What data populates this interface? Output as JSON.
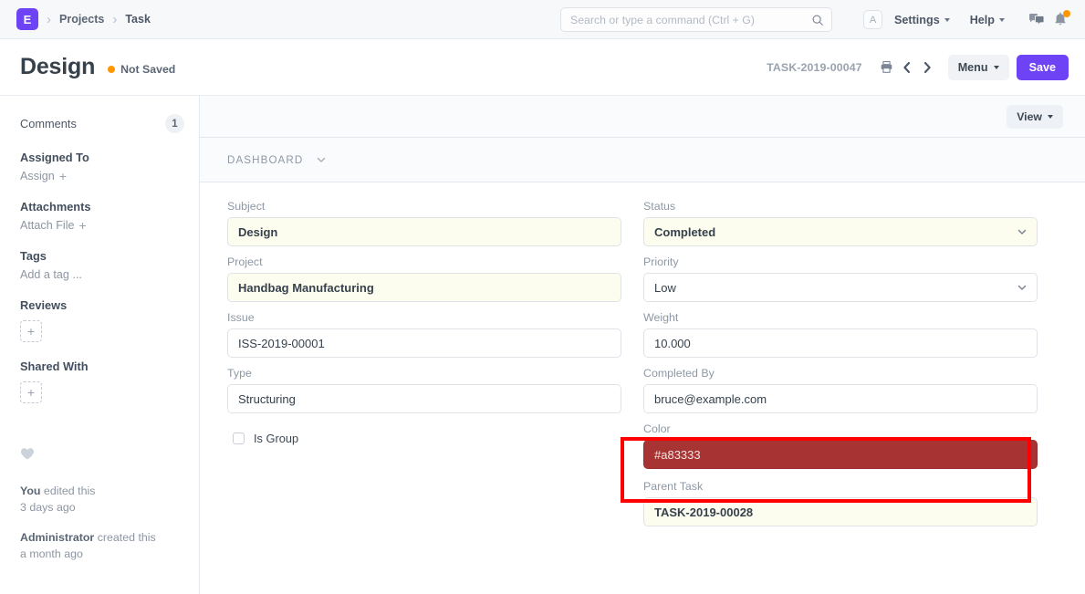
{
  "navbar": {
    "logo_letter": "E",
    "breadcrumbs": [
      {
        "label": "Projects"
      },
      {
        "label": "Task"
      }
    ],
    "search": {
      "value": "",
      "placeholder": "Search or type a command (Ctrl + G)"
    },
    "avatar_letter": "A",
    "settings_label": "Settings",
    "help_label": "Help",
    "notification_badge_color": "#ff9800"
  },
  "page_head": {
    "title": "Design",
    "status_label": "Not Saved",
    "status_color": "#ff9800",
    "doc_id": "TASK-2019-00047",
    "menu_label": "Menu",
    "save_label": "Save",
    "save_color": "#6e42f5"
  },
  "sidebar": {
    "comments_label": "Comments",
    "comments_count": "1",
    "assigned_to_label": "Assigned To",
    "assign_action": "Assign",
    "attachments_label": "Attachments",
    "attach_action": "Attach File",
    "tags_label": "Tags",
    "tags_placeholder": "Add a tag ...",
    "reviews_label": "Reviews",
    "shared_with_label": "Shared With",
    "add_symbol": "+",
    "audit": [
      {
        "actor": "You",
        "text": " edited this",
        "time": "3 days ago"
      },
      {
        "actor": "Administrator",
        "text": " created this",
        "time": "a month ago"
      }
    ]
  },
  "card": {
    "view_label": "View",
    "section_label": "DASHBOARD"
  },
  "form": {
    "left": [
      {
        "label": "Subject",
        "value": "Design",
        "type": "text",
        "bold": true,
        "modified": true
      },
      {
        "label": "Project",
        "value": "Handbag Manufacturing",
        "type": "text",
        "bold": true,
        "modified": true
      },
      {
        "label": "Issue",
        "value": "ISS-2019-00001",
        "type": "text",
        "bold": false,
        "modified": false
      },
      {
        "label": "Type",
        "value": "Structuring",
        "type": "text",
        "bold": false,
        "modified": false
      }
    ],
    "checkbox": {
      "label": "Is Group",
      "checked": false
    },
    "right": [
      {
        "label": "Status",
        "value": "Completed",
        "type": "select",
        "bold": true,
        "modified": true
      },
      {
        "label": "Priority",
        "value": "Low",
        "type": "select",
        "bold": false,
        "modified": false
      },
      {
        "label": "Weight",
        "value": "10.000",
        "type": "text",
        "bold": false,
        "modified": false
      },
      {
        "label": "Completed By",
        "value": "bruce@example.com",
        "type": "text",
        "bold": false,
        "modified": false
      },
      {
        "label": "Color",
        "value": "#a83333",
        "type": "color",
        "bold": false,
        "modified": false
      },
      {
        "label": "Parent Task",
        "value": "TASK-2019-00028",
        "type": "text",
        "bold": true,
        "modified": true
      }
    ],
    "color_field_value": "#a83333",
    "highlight_color": "#ff0000"
  }
}
